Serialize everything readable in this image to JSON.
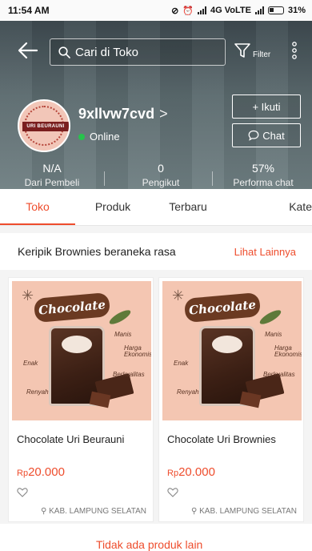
{
  "status_bar": {
    "time": "11:54 AM",
    "network": "4G VoLTE",
    "battery": "31%"
  },
  "header": {
    "search_placeholder": "Cari di Toko",
    "filter_label": "Filter",
    "shop_name": "9xllvw7cvd",
    "shop_chevron": ">",
    "online_label": "Online",
    "avatar_text": "URI BEURAUNI",
    "follow_label": "+ Ikuti",
    "chat_label": "Chat"
  },
  "stats": [
    {
      "value": "N/A",
      "label": "Dari Pembeli"
    },
    {
      "value": "0",
      "label": "Pengikut"
    },
    {
      "value": "57%",
      "label": "Performa chat"
    }
  ],
  "tabs": [
    {
      "label": "Toko",
      "active": true
    },
    {
      "label": "Produk",
      "active": false
    },
    {
      "label": "Terbaru",
      "active": false
    },
    {
      "label": "Kate",
      "active": false
    }
  ],
  "section": {
    "title": "Keripik Brownies beraneka rasa",
    "link": "Lihat Lainnya"
  },
  "products": [
    {
      "image_title": "Chocolate",
      "name": "Chocolate Uri Beurauni",
      "currency": "Rp",
      "price": "20.000",
      "location": "KAB. LAMPUNG SELATAN"
    },
    {
      "image_title": "Chocolate",
      "name": "Chocolate Uri Brownies",
      "currency": "Rp",
      "price": "20.000",
      "location": "KAB. LAMPUNG SELATAN"
    }
  ],
  "image_tags": [
    "Manis",
    "Enak",
    "Berkualitas",
    "Renyah",
    "Harga Ekonomis"
  ],
  "bottom_text": "Tidak ada produk lain",
  "colors": {
    "accent": "#ee4d2d",
    "online": "#27c24c"
  }
}
